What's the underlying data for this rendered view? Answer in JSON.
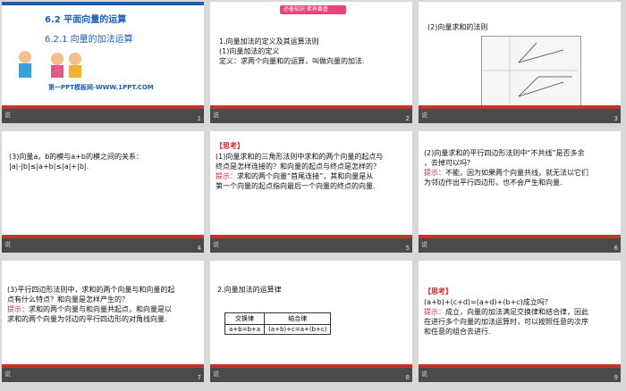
{
  "slides": [
    {
      "number": "1",
      "footer": "说",
      "title": "6.2  平面向量的运算",
      "subtitle": "6.2.1  向量的加法运算",
      "site": "第一PPT模板网-WWW.1PPT.COM"
    },
    {
      "number": "2",
      "footer": "说",
      "tag": "必备知识·素养奠基",
      "l1": "1.向量加法的定义及其运算法则",
      "l2": "(1)向量加法的定义",
      "l3": "定义：求两个向量和的运算，叫做向量的加法."
    },
    {
      "number": "3",
      "footer": "说",
      "title": "(2)向量求和的法则"
    },
    {
      "number": "4",
      "footer": "说",
      "l1": "(3)向量a，b的模与a+b的模之间的关系：",
      "l2": "|a|-|b|≤|a+b|≤|a|+|b|."
    },
    {
      "number": "5",
      "footer": "说",
      "head": "【思考】",
      "q1": "(1)向量求和的三角形法则中求和的两个向量的起点与",
      "q2": "终点是怎样连接的？和向量的起点与终点是怎样的？",
      "hint": "提示：",
      "a1": "求和的两个向量“首尾连接”，其和向量是从",
      "a2": "第一个向量的起点指向最后一个向量的终点的向量."
    },
    {
      "number": "6",
      "footer": "说",
      "q1": "(2)向量求和的平行四边形法则中“不共线”是否多余",
      "q2": "，去掉可以吗？",
      "hint": "提示：",
      "a1": "不能，因为如果两个向量共线，就无法以它们",
      "a2": "为邻边作出平行四边形，也不会产生和向量."
    },
    {
      "number": "7",
      "footer": "说",
      "q1": "(3)平行四边形法则中，求和的两个向量与和向量的起",
      "q2": "点有什么特点？和向量是怎样产生的？",
      "hint": "提示：",
      "a1": "求和的两个向量与和向量共起点，和向量是以",
      "a2": "求和的两个向量为邻边的平行四边形的对角线向量."
    },
    {
      "number": "8",
      "footer": "说",
      "title": "2.向量加法的运算律",
      "law_headers": [
        "交换律",
        "结合律"
      ],
      "law_values": [
        "a+b=b+a",
        "(a+b)+c=a+(b+c)"
      ]
    },
    {
      "number": "9",
      "footer": "说",
      "head": "【思考】",
      "q1": "(a+b)+(c+d)=(a+d)+(b+c)成立吗？",
      "hint": "提示：",
      "a1": "成立，向量的加法满足交换律和结合律，因此",
      "a2": "在进行多个向量的加法运算时，可以按照任意的次序",
      "a3": "和任意的组合去进行."
    }
  ]
}
